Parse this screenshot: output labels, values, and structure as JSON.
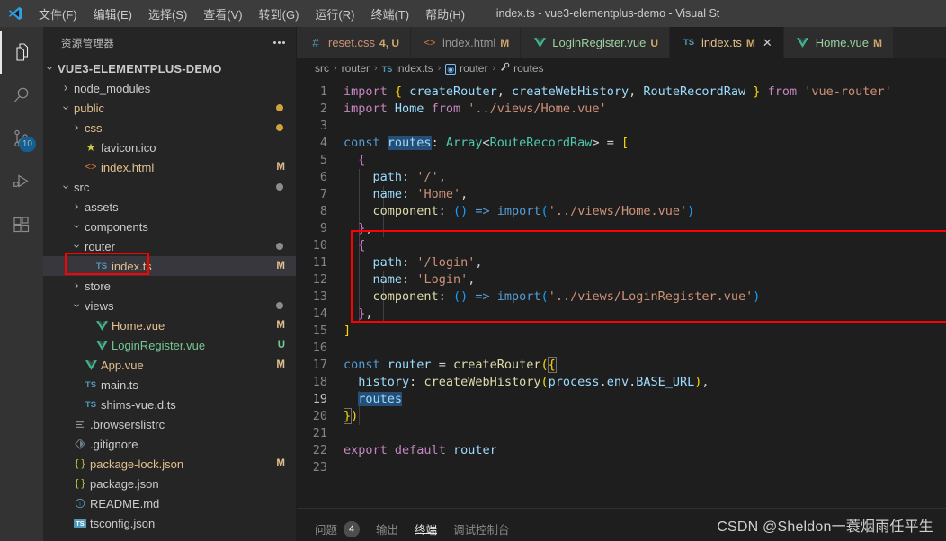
{
  "titlebar": {
    "window_title": "index.ts - vue3-elementplus-demo - Visual St",
    "menus": [
      {
        "label": "文件(F)"
      },
      {
        "label": "编辑(E)"
      },
      {
        "label": "选择(S)"
      },
      {
        "label": "查看(V)"
      },
      {
        "label": "转到(G)"
      },
      {
        "label": "运行(R)"
      },
      {
        "label": "终端(T)"
      },
      {
        "label": "帮助(H)"
      }
    ]
  },
  "activitybar": {
    "items": [
      {
        "name": "explorer-icon",
        "active": true,
        "badge": ""
      },
      {
        "name": "search-icon",
        "active": false,
        "badge": ""
      },
      {
        "name": "source-control-icon",
        "active": false,
        "badge": "10"
      },
      {
        "name": "run-debug-icon",
        "active": false,
        "badge": ""
      },
      {
        "name": "extensions-icon",
        "active": false,
        "badge": ""
      }
    ]
  },
  "sidebar": {
    "title": "资源管理器",
    "root": "VUE3-ELEMENTPLUS-DEMO",
    "files": [
      {
        "label": "node_modules",
        "indent": 1,
        "twisty": "right",
        "icon": "",
        "status": "",
        "dot": ""
      },
      {
        "label": "public",
        "indent": 1,
        "twisty": "down",
        "icon": "",
        "status": "",
        "dot": "#cfa23b",
        "color": "#e2c08d"
      },
      {
        "label": "css",
        "indent": 2,
        "twisty": "right",
        "icon": "",
        "status": "",
        "dot": "#cfa23b",
        "color": "#e2c08d"
      },
      {
        "label": "favicon.ico",
        "indent": 2,
        "twisty": "none",
        "icon": "star",
        "status": "",
        "dot": ""
      },
      {
        "label": "index.html",
        "indent": 2,
        "twisty": "none",
        "icon": "html",
        "status": "M",
        "dot": "",
        "statusColor": "#e2c08d",
        "color": "#e2c08d"
      },
      {
        "label": "src",
        "indent": 1,
        "twisty": "down",
        "icon": "",
        "status": "",
        "dot": "#8c8c8c"
      },
      {
        "label": "assets",
        "indent": 2,
        "twisty": "right",
        "icon": "",
        "status": "",
        "dot": ""
      },
      {
        "label": "components",
        "indent": 2,
        "twisty": "down",
        "icon": "",
        "status": "",
        "dot": ""
      },
      {
        "label": "router",
        "indent": 2,
        "twisty": "down",
        "icon": "",
        "status": "",
        "dot": "#8c8c8c"
      },
      {
        "label": "index.ts",
        "indent": 3,
        "twisty": "none",
        "icon": "ts",
        "status": "M",
        "dot": "",
        "selected": true,
        "statusColor": "#e2c08d",
        "color": "#e2c08d"
      },
      {
        "label": "store",
        "indent": 2,
        "twisty": "right",
        "icon": "",
        "status": "",
        "dot": ""
      },
      {
        "label": "views",
        "indent": 2,
        "twisty": "down",
        "icon": "",
        "status": "",
        "dot": "#8c8c8c"
      },
      {
        "label": "Home.vue",
        "indent": 3,
        "twisty": "none",
        "icon": "vue",
        "status": "M",
        "dot": "",
        "statusColor": "#e2c08d",
        "color": "#e2c08d"
      },
      {
        "label": "LoginRegister.vue",
        "indent": 3,
        "twisty": "none",
        "icon": "vue",
        "status": "U",
        "dot": "",
        "statusColor": "#73c991",
        "color": "#73c991"
      },
      {
        "label": "App.vue",
        "indent": 2,
        "twisty": "none",
        "icon": "vue",
        "status": "M",
        "dot": "",
        "statusColor": "#e2c08d",
        "color": "#e2c08d"
      },
      {
        "label": "main.ts",
        "indent": 2,
        "twisty": "none",
        "icon": "ts",
        "status": "",
        "dot": ""
      },
      {
        "label": "shims-vue.d.ts",
        "indent": 2,
        "twisty": "none",
        "icon": "ts",
        "status": "",
        "dot": ""
      },
      {
        "label": ".browserslistrc",
        "indent": 1,
        "twisty": "none",
        "icon": "lines",
        "status": "",
        "dot": ""
      },
      {
        "label": ".gitignore",
        "indent": 1,
        "twisty": "none",
        "icon": "git",
        "status": "",
        "dot": ""
      },
      {
        "label": "package-lock.json",
        "indent": 1,
        "twisty": "none",
        "icon": "json",
        "status": "M",
        "dot": "",
        "statusColor": "#e2c08d",
        "color": "#e2c08d"
      },
      {
        "label": "package.json",
        "indent": 1,
        "twisty": "none",
        "icon": "json",
        "status": "",
        "dot": ""
      },
      {
        "label": "README.md",
        "indent": 1,
        "twisty": "none",
        "icon": "info",
        "status": "",
        "dot": ""
      },
      {
        "label": "tsconfig.json",
        "indent": 1,
        "twisty": "none",
        "icon": "tsconfig",
        "status": "",
        "dot": ""
      }
    ]
  },
  "editor": {
    "tabs": [
      {
        "label": "reset.css",
        "modifier": "4, U",
        "icon": "css",
        "active": false,
        "close": false
      },
      {
        "label": "index.html",
        "modifier": "M",
        "icon": "html",
        "active": false,
        "close": false
      },
      {
        "label": "LoginRegister.vue",
        "modifier": "U",
        "icon": "vue",
        "active": false,
        "close": false
      },
      {
        "label": "index.ts",
        "modifier": "M",
        "icon": "ts",
        "active": true,
        "close": true
      },
      {
        "label": "Home.vue",
        "modifier": "M",
        "icon": "vue",
        "active": false,
        "close": false
      }
    ],
    "breadcrumb": [
      {
        "label": "src",
        "icon": ""
      },
      {
        "label": "router",
        "icon": ""
      },
      {
        "label": "index.ts",
        "icon": "ts"
      },
      {
        "label": "router",
        "icon": "module"
      },
      {
        "label": "routes",
        "icon": "wrench"
      }
    ],
    "line_numbers": [
      "1",
      "2",
      "3",
      "4",
      "5",
      "6",
      "7",
      "8",
      "9",
      "10",
      "11",
      "12",
      "13",
      "14",
      "15",
      "16",
      "17",
      "18",
      "19",
      "20",
      "21",
      "22",
      "23"
    ],
    "current_line": "19",
    "dirty_lines": [
      "8",
      "10",
      "11",
      "12",
      "13",
      "14"
    ],
    "code_lines": [
      "import { createRouter, createWebHistory, RouteRecordRaw } from 'vue-router'",
      "import Home from '../views/Home.vue'",
      "",
      "const routes: Array<RouteRecordRaw> = [",
      "  {",
      "    path: '/',",
      "    name: 'Home',",
      "    component: () => import('../views/Home.vue')",
      "  },",
      "  {",
      "    path: '/login',",
      "    name: 'Login',",
      "    component: () => import('../views/LoginRegister.vue')",
      "  },",
      "]",
      "",
      "const router = createRouter({",
      "  history: createWebHistory(process.env.BASE_URL),",
      "  routes",
      "})",
      "",
      "export default router",
      ""
    ]
  },
  "panel": {
    "tabs": [
      {
        "label": "问题",
        "count": "4",
        "active": false
      },
      {
        "label": "输出",
        "count": "",
        "active": false
      },
      {
        "label": "终端",
        "count": "",
        "active": true
      },
      {
        "label": "调试控制台",
        "count": "",
        "active": false
      }
    ],
    "watermark": "CSDN @Sheldon一蓑烟雨任平生"
  },
  "annotations": {
    "color": "#ff0000",
    "boxes": [
      "sidebar-index-ts",
      "code-login-route-block"
    ]
  }
}
